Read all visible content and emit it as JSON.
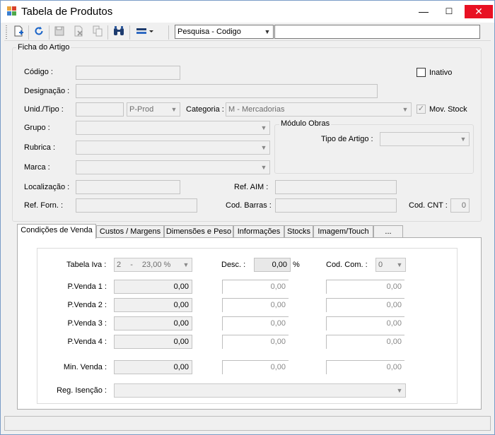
{
  "window": {
    "title": "Tabela de Produtos"
  },
  "toolbar": {
    "search_mode": "Pesquisa - Codigo",
    "search_value": ""
  },
  "ficha": {
    "group_title": "Ficha do Artigo",
    "codigo_label": "Código :",
    "codigo_value": "",
    "inativo_label": "Inativo",
    "inativo_checked": false,
    "designacao_label": "Designação :",
    "designacao_value": "",
    "unid_label": "Unid./Tipo :",
    "unid_value": "",
    "tipo_value": "P-Prod",
    "categoria_label": "Categoria :",
    "categoria_value": "M - Mercadorias",
    "mov_stock_label": "Mov. Stock",
    "mov_stock_checked": true,
    "grupo_label": "Grupo :",
    "grupo_value": "",
    "rubrica_label": "Rubrica :",
    "rubrica_value": "",
    "marca_label": "Marca :",
    "marca_value": "",
    "modulo_obras_title": "Módulo Obras",
    "tipo_artigo_label": "Tipo de Artigo :",
    "tipo_artigo_value": "",
    "localizacao_label": "Localização :",
    "localizacao_value": "",
    "ref_aim_label": "Ref. AIM :",
    "ref_aim_value": "",
    "ref_forn_label": "Ref. Forn. :",
    "ref_forn_value": "",
    "cod_barras_label": "Cod. Barras :",
    "cod_barras_value": "",
    "cod_cnt_label": "Cod. CNT :",
    "cod_cnt_value": "0"
  },
  "tabs": [
    {
      "label": "Condições de Venda"
    },
    {
      "label": "Custos / Margens"
    },
    {
      "label": "Dimensões e Peso"
    },
    {
      "label": "Informações"
    },
    {
      "label": "Stocks"
    },
    {
      "label": "Imagem/Touch"
    },
    {
      "label": "..."
    }
  ],
  "vendas": {
    "tabela_iva_label": "Tabela Iva :",
    "tabela_iva_code": "2",
    "tabela_iva_sep": "-",
    "tabela_iva_rate": "23,00 %",
    "desc_label": "Desc. :",
    "desc_value": "0,00",
    "desc_unit": "%",
    "cod_com_label": "Cod. Com. :",
    "cod_com_value": "0",
    "pvenda1_label": "P.Venda 1 :",
    "pvenda2_label": "P.Venda 2 :",
    "pvenda3_label": "P.Venda 3 :",
    "pvenda4_label": "P.Venda 4 :",
    "min_venda_label": "Min. Venda :",
    "reg_isencao_label": "Reg. Isenção :",
    "reg_isencao_value": "",
    "rows": [
      {
        "a": "0,00",
        "b": "0,00",
        "c": "0,00"
      },
      {
        "a": "0,00",
        "b": "0,00",
        "c": "0,00"
      },
      {
        "a": "0,00",
        "b": "0,00",
        "c": "0,00"
      },
      {
        "a": "0,00",
        "b": "0,00",
        "c": "0,00"
      }
    ],
    "min_row": {
      "a": "0,00",
      "b": "0,00",
      "c": "0,00"
    }
  },
  "icons": {
    "new": "new-document-icon",
    "refresh": "refresh-icon",
    "save": "save-icon",
    "delete": "delete-icon",
    "copy": "copy-icon",
    "find": "binoculars-icon",
    "view": "view-options-icon"
  },
  "colors": {
    "close_button": "#e81123",
    "window_border": "#7a9cc7"
  }
}
